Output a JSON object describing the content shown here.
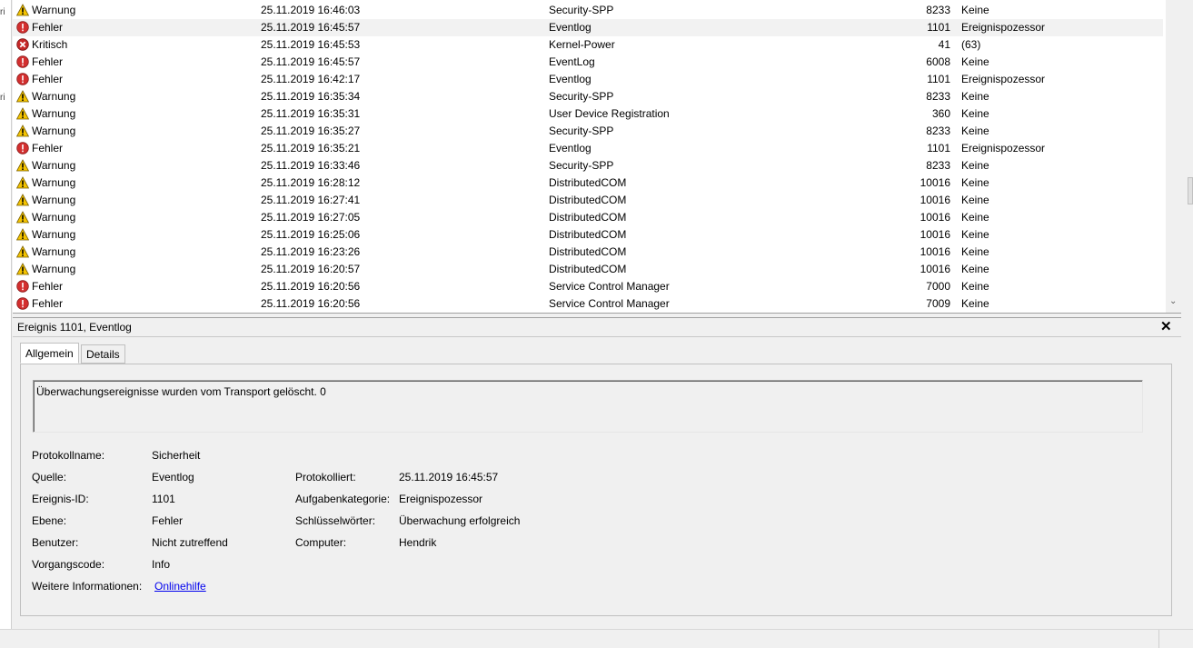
{
  "left_strip": {
    "chars": [
      "ri",
      "ri"
    ]
  },
  "events": [
    {
      "level": "Warnung",
      "icon": "warning-icon",
      "datetime": "25.11.2019 16:46:03",
      "source": "Security-SPP",
      "id": "8233",
      "task": "Keine"
    },
    {
      "level": "Fehler",
      "icon": "error-icon",
      "datetime": "25.11.2019 16:45:57",
      "source": "Eventlog",
      "id": "1101",
      "task": "Ereignispozessor",
      "selected": true
    },
    {
      "level": "Kritisch",
      "icon": "critical-icon",
      "datetime": "25.11.2019 16:45:53",
      "source": "Kernel-Power",
      "id": "41",
      "task": "(63)"
    },
    {
      "level": "Fehler",
      "icon": "error-icon",
      "datetime": "25.11.2019 16:45:57",
      "source": "EventLog",
      "id": "6008",
      "task": "Keine"
    },
    {
      "level": "Fehler",
      "icon": "error-icon",
      "datetime": "25.11.2019 16:42:17",
      "source": "Eventlog",
      "id": "1101",
      "task": "Ereignispozessor"
    },
    {
      "level": "Warnung",
      "icon": "warning-icon",
      "datetime": "25.11.2019 16:35:34",
      "source": "Security-SPP",
      "id": "8233",
      "task": "Keine"
    },
    {
      "level": "Warnung",
      "icon": "warning-icon",
      "datetime": "25.11.2019 16:35:31",
      "source": "User Device Registration",
      "id": "360",
      "task": "Keine"
    },
    {
      "level": "Warnung",
      "icon": "warning-icon",
      "datetime": "25.11.2019 16:35:27",
      "source": "Security-SPP",
      "id": "8233",
      "task": "Keine"
    },
    {
      "level": "Fehler",
      "icon": "error-icon",
      "datetime": "25.11.2019 16:35:21",
      "source": "Eventlog",
      "id": "1101",
      "task": "Ereignispozessor"
    },
    {
      "level": "Warnung",
      "icon": "warning-icon",
      "datetime": "25.11.2019 16:33:46",
      "source": "Security-SPP",
      "id": "8233",
      "task": "Keine"
    },
    {
      "level": "Warnung",
      "icon": "warning-icon",
      "datetime": "25.11.2019 16:28:12",
      "source": "DistributedCOM",
      "id": "10016",
      "task": "Keine"
    },
    {
      "level": "Warnung",
      "icon": "warning-icon",
      "datetime": "25.11.2019 16:27:41",
      "source": "DistributedCOM",
      "id": "10016",
      "task": "Keine"
    },
    {
      "level": "Warnung",
      "icon": "warning-icon",
      "datetime": "25.11.2019 16:27:05",
      "source": "DistributedCOM",
      "id": "10016",
      "task": "Keine"
    },
    {
      "level": "Warnung",
      "icon": "warning-icon",
      "datetime": "25.11.2019 16:25:06",
      "source": "DistributedCOM",
      "id": "10016",
      "task": "Keine"
    },
    {
      "level": "Warnung",
      "icon": "warning-icon",
      "datetime": "25.11.2019 16:23:26",
      "source": "DistributedCOM",
      "id": "10016",
      "task": "Keine"
    },
    {
      "level": "Warnung",
      "icon": "warning-icon",
      "datetime": "25.11.2019 16:20:57",
      "source": "DistributedCOM",
      "id": "10016",
      "task": "Keine"
    },
    {
      "level": "Fehler",
      "icon": "error-icon",
      "datetime": "25.11.2019 16:20:56",
      "source": "Service Control Manager",
      "id": "7000",
      "task": "Keine"
    },
    {
      "level": "Fehler",
      "icon": "error-icon",
      "datetime": "25.11.2019 16:20:56",
      "source": "Service Control Manager",
      "id": "7009",
      "task": "Keine"
    }
  ],
  "detail": {
    "title": "Ereignis 1101, Eventlog",
    "close_glyph": "✕",
    "tabs": [
      "Allgemein",
      "Details"
    ],
    "description": "Überwachungsereignisse wurden vom Transport gelöscht. 0",
    "labels": {
      "log_name": "Protokollname:",
      "source": "Quelle:",
      "event_id": "Ereignis-ID:",
      "level": "Ebene:",
      "user": "Benutzer:",
      "opcode": "Vorgangscode:",
      "more_info": "Weitere Informationen:",
      "logged": "Protokolliert:",
      "task_category": "Aufgabenkategorie:",
      "keywords": "Schlüsselwörter:",
      "computer": "Computer:"
    },
    "values": {
      "log_name": "Sicherheit",
      "source": "Eventlog",
      "event_id": "1101",
      "level": "Fehler",
      "user": "Nicht zutreffend",
      "opcode": "Info",
      "more_info": "Onlinehilfe",
      "logged": "25.11.2019 16:45:57",
      "task_category": "Ereignispozessor",
      "keywords": "Überwachung erfolgreich",
      "computer": "Hendrik"
    }
  },
  "colors": {
    "warning": "#f5c400",
    "error": "#d32f2f",
    "critical": "#c62828",
    "link": "#0000ee"
  }
}
